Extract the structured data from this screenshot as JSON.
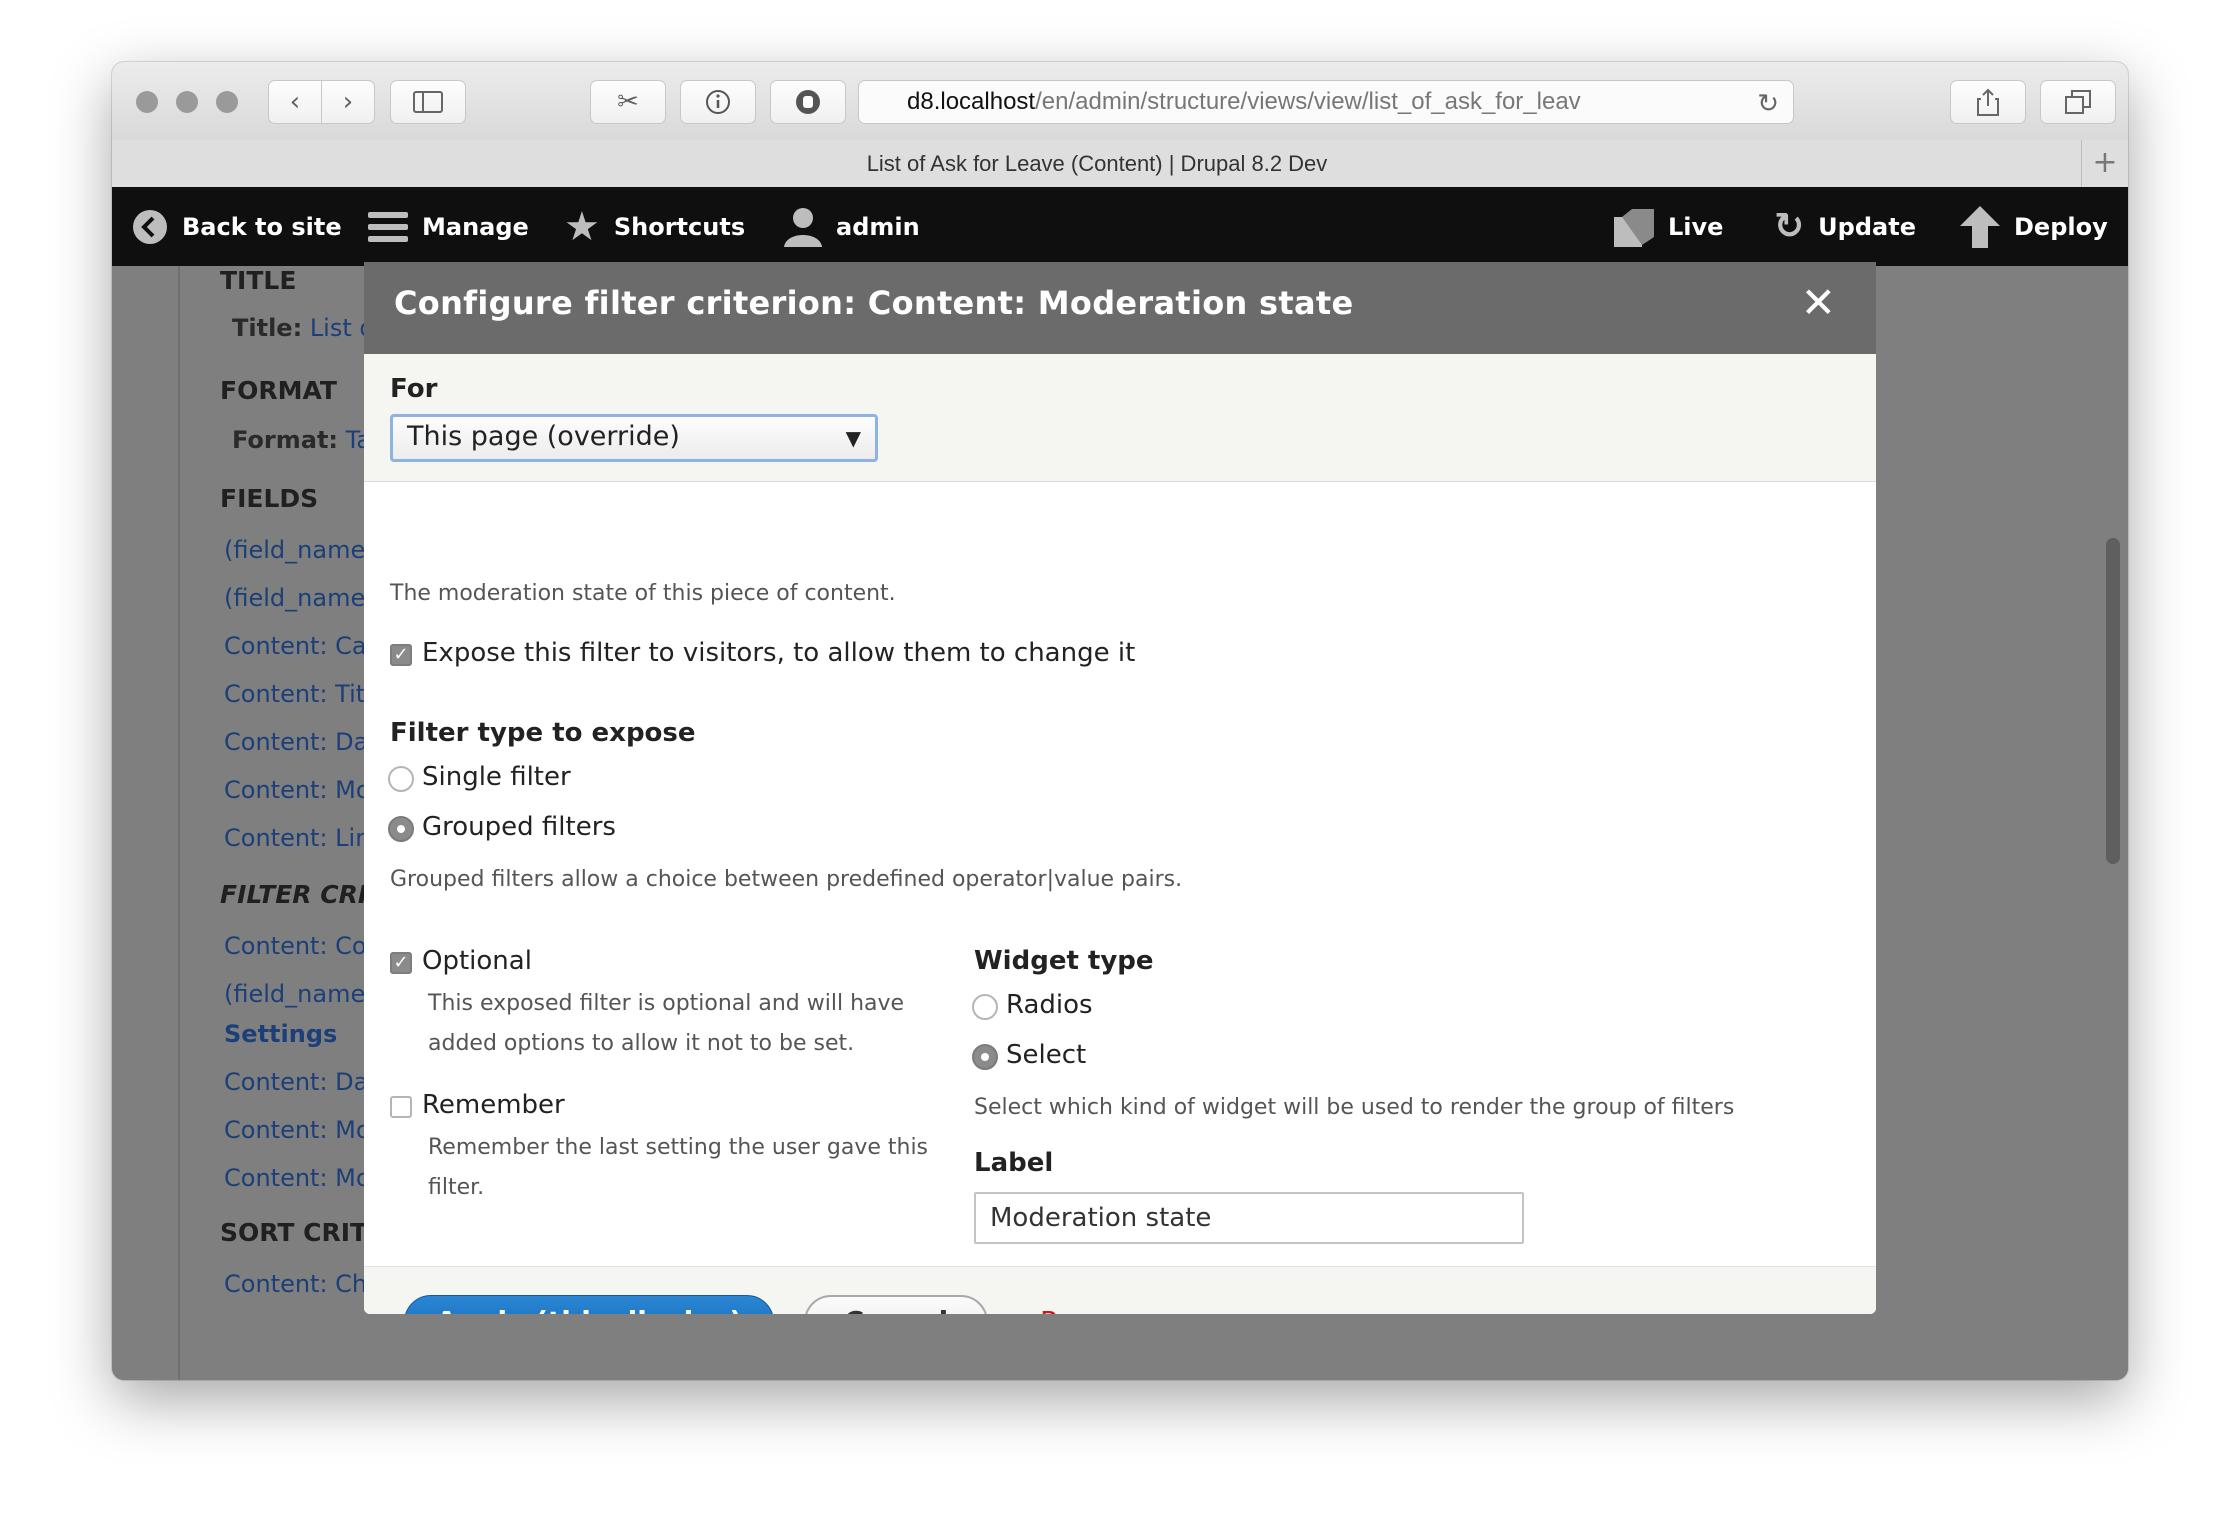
{
  "browser": {
    "url_host": "d8.localhost",
    "url_path": "/en/admin/structure/views/view/list_of_ask_for_leav",
    "tab_title": "List of Ask for Leave (Content) | Drupal 8.2 Dev"
  },
  "admin_toolbar": {
    "back_to_site": "Back to site",
    "manage": "Manage",
    "shortcuts": "Shortcuts",
    "user": "admin",
    "live": "Live",
    "update": "Update",
    "deploy": "Deploy"
  },
  "background": {
    "title_heading": "TITLE",
    "title_label": "Title:",
    "title_value": "List o",
    "format_heading": "FORMAT",
    "format_label": "Format:",
    "format_value": "Ta",
    "fields_heading": "FIELDS",
    "fields": [
      "(field_name:",
      "(field_name:",
      "Content: Ca",
      "Content: Tit",
      "Content: Da",
      "Content: Mo",
      "Content: Lin"
    ],
    "filter_heading": "FILTER CRI",
    "filters": [
      "Content: Co",
      "(field_name:"
    ],
    "settings_label": "Settings",
    "filters_more": [
      "Content: Da",
      "Content: Mo",
      "Content: Mo"
    ],
    "sort_heading": "SORT CRIT",
    "sorts": [
      "Content: Ch"
    ]
  },
  "dialog": {
    "title": "Configure filter criterion: Content: Moderation state",
    "for_label": "For",
    "for_value": "This page (override)",
    "description": "The moderation state of this piece of content.",
    "expose_label": "Expose this filter to visitors, to allow them to change it",
    "filter_type_label": "Filter type to expose",
    "single_filter": "Single filter",
    "grouped_filters": "Grouped filters",
    "grouped_desc": "Grouped filters allow a choice between predefined operator|value pairs.",
    "optional_label": "Optional",
    "optional_desc_1": "This exposed filter is optional and will have",
    "optional_desc_2": "added options to allow it not to be set.",
    "remember_label": "Remember",
    "remember_desc_1": "Remember the last setting the user gave this",
    "remember_desc_2": "filter.",
    "widget_type_label": "Widget type",
    "radios": "Radios",
    "select": "Select",
    "widget_desc": "Select which kind of widget will be used to render the group of filters",
    "label_label": "Label",
    "label_value": "Moderation state",
    "apply_button": "Apply (this display)",
    "cancel_button": "Cancel",
    "remove_link": "Remove"
  }
}
